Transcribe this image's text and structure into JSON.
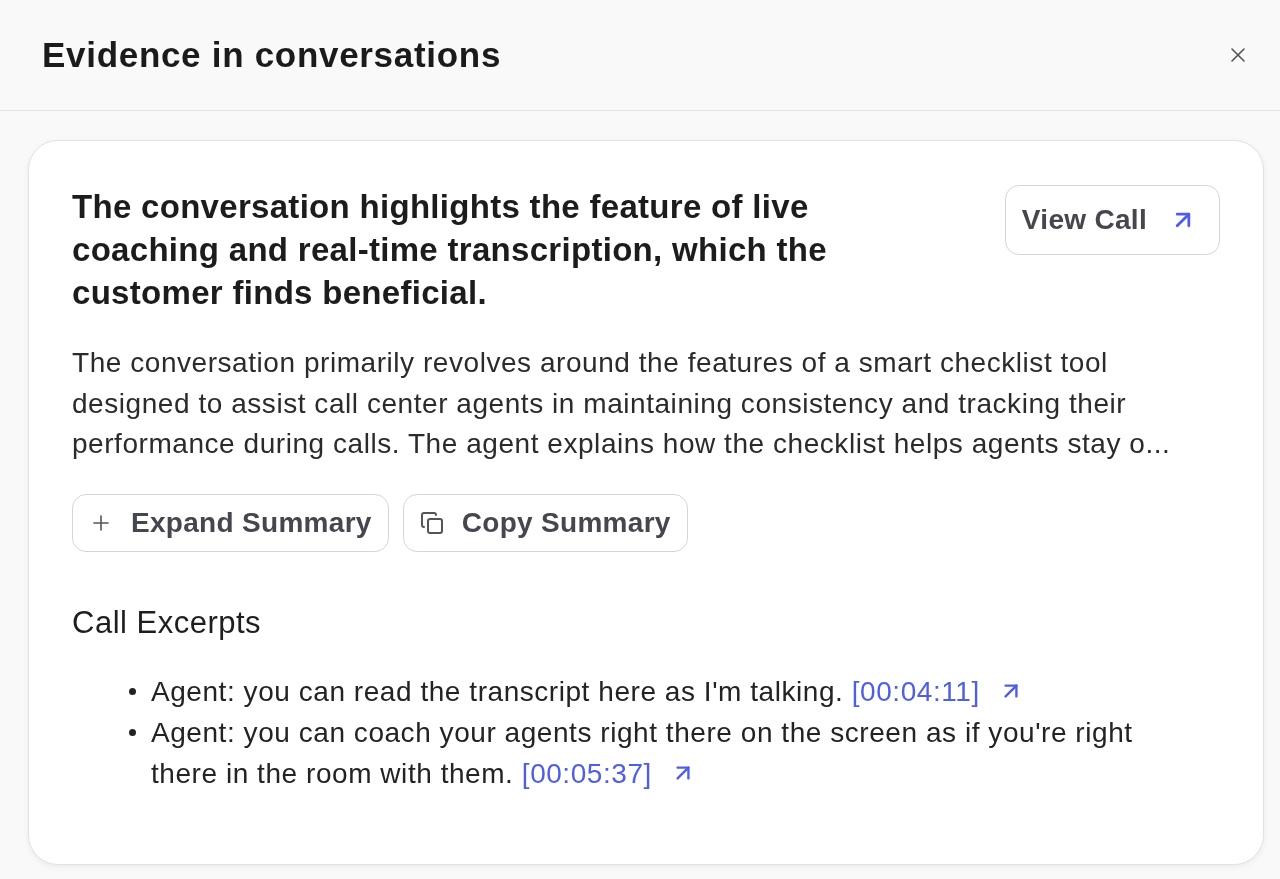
{
  "dialog": {
    "title": "Evidence in conversations"
  },
  "evidence": {
    "heading": "The conversation highlights the feature of live coaching and real-time transcription, which the customer finds beneficial.",
    "view_call_button": "View Call",
    "summary": "The conversation primarily revolves around the features of a smart checklist tool designed to assist call center agents in maintaining consistency and tracking their performance during calls. The agent explains how the checklist helps agents stay o...",
    "actions": [
      {
        "kind": "expand",
        "label": "Expand Summary"
      },
      {
        "kind": "copy",
        "label": "Copy Summary"
      }
    ],
    "excerpts_title": "Call Excerpts",
    "excerpts": [
      {
        "text": "Agent: you can read the transcript here as I'm talking.",
        "timestamp": "[00:04:11]"
      },
      {
        "text": "Agent: you can coach your agents right there on the screen as if you're right there in the room with them.",
        "timestamp": "[00:05:37]"
      }
    ]
  }
}
